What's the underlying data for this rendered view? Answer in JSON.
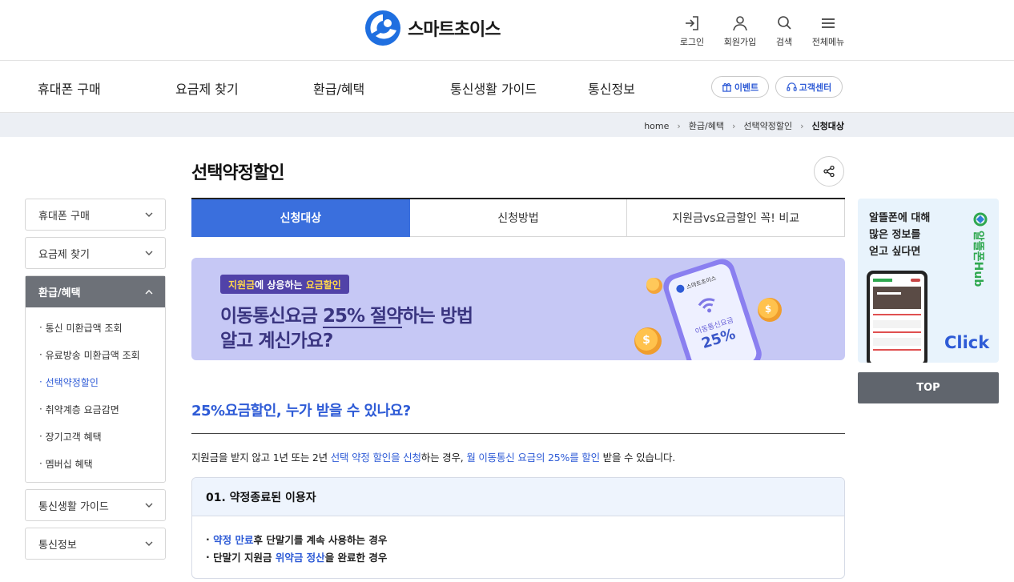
{
  "header": {
    "logo_text": "스마트초이스",
    "utils": [
      {
        "label": "로그인",
        "icon": "login-icon"
      },
      {
        "label": "회원가입",
        "icon": "user-icon"
      },
      {
        "label": "검색",
        "icon": "search-icon"
      },
      {
        "label": "전체메뉴",
        "icon": "menu-icon"
      }
    ]
  },
  "gnb": {
    "items": [
      "휴대폰 구매",
      "요금제 찾기",
      "환급/혜택",
      "통신생활 가이드",
      "통신정보"
    ],
    "event_label": "이벤트",
    "support_label": "고객센터"
  },
  "breadcrumb": {
    "items": [
      "home",
      "환급/혜택",
      "선택약정할인"
    ],
    "current": "신청대상"
  },
  "side": {
    "before": [
      "휴대폰 구매",
      "요금제 찾기"
    ],
    "open_label": "환급/혜택",
    "sub_items": [
      "통신 미환급액 조회",
      "유료방송 미환급액 조회",
      "선택약정할인",
      "취약계층 요금감면",
      "장기고객 혜택",
      "멤버십 혜택"
    ],
    "active_sub": "선택약정할인",
    "after": [
      "통신생활 가이드",
      "통신정보"
    ]
  },
  "main": {
    "title": "선택약정할인",
    "tabs": [
      "신청대상",
      "신청방법",
      "지원금vs요금할인 꼭! 비교"
    ],
    "active_tab": "신청대상",
    "banner": {
      "tag_highlight_1": "지원금",
      "tag_text_1": "에 상응하는 ",
      "tag_highlight_2": "요금할인",
      "line1_prefix": "이동통신요금 ",
      "line1_underlined": "25% 절약",
      "line1_suffix": "하는 방법",
      "line2": "알고 계신가요?",
      "phone_text": "이동통신요금",
      "phone_percent": "25%",
      "phone_brand": "스마트초이스"
    },
    "section_title": "25%요금할인, 누가 받을 수 있나요?",
    "desc": {
      "p1": "지원금을 받지 않고 1년 또는 2년 ",
      "h1": "선택 약정 할인을 신청",
      "p2": "하는 경우, ",
      "h2": "월 이동통신 요금의 25%를 할인",
      "p3": " 받을 수 있습니다."
    },
    "card": {
      "title": "01. 약정종료된 이용자",
      "line1_bullet": "· ",
      "line1_hl": "약정 만료",
      "line1_rest": "후 단말기를 계속 사용하는 경우",
      "line2_bullet": "· ",
      "line2_pre": "단말기 지원금 ",
      "line2_hl": "위약금 정산",
      "line2_rest": "을 완료한 경우"
    }
  },
  "ad": {
    "line1": "알뜰폰에 대해",
    "line2": "많은 정보를",
    "line3": "얻고 싶다면",
    "brand": "알뜰폰Hub",
    "click": "Click"
  },
  "top_label": "TOP",
  "colors": {
    "accent": "#2e5bd6",
    "tab_active": "#3a6fdd",
    "banner_bg": "#c6c8f5",
    "side_open": "#6d7178"
  }
}
